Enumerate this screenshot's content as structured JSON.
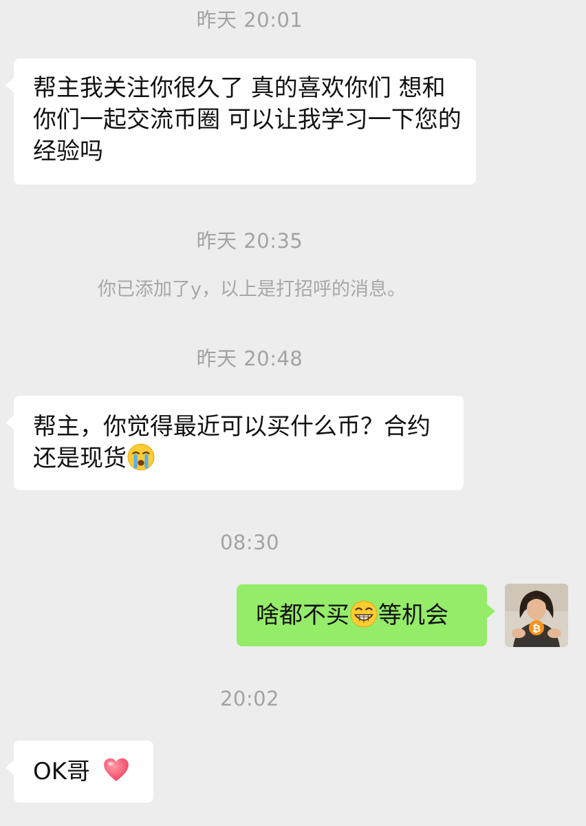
{
  "chat": {
    "ts1": "昨天 20:01",
    "msg1": "帮主我关注你很久了 真的喜欢你们 想和你们一起交流币圈 可以让我学习一下您的经验吗",
    "ts2": "昨天 20:35",
    "system_notice": "你已添加了y，以上是打招呼的消息。",
    "ts3": "昨天 20:48",
    "msg2": "帮主，你觉得最近可以买什么币？合约还是现货",
    "msg2_emoji": "crying-face-icon",
    "ts4": "08:30",
    "reply_before_emoji": "啥都不买",
    "reply_emoji": "grinning-face-icon",
    "reply_after_emoji": "等机会",
    "ts5": "20:02",
    "msg3": "OK哥",
    "msg3_emoji": "heart-icon"
  },
  "colors": {
    "background": "#ededed",
    "incoming_bubble": "#ffffff",
    "outgoing_bubble": "#95ec69",
    "timestamp_text": "#a3a3a3"
  }
}
